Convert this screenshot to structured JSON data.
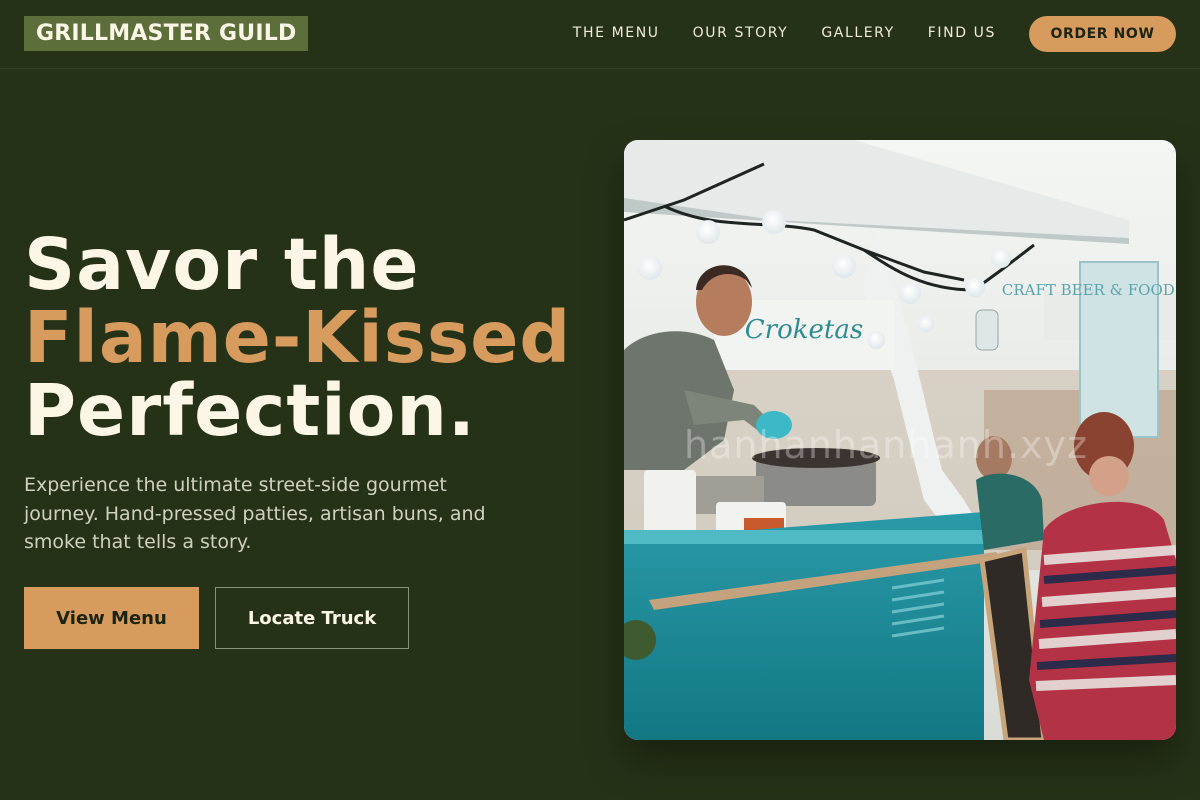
{
  "brand": {
    "name": "GRILLMASTER GUILD"
  },
  "nav": {
    "links": [
      "THE MENU",
      "OUR STORY",
      "GALLERY",
      "FIND US"
    ],
    "cta": "ORDER NOW"
  },
  "hero": {
    "title_line1": "Savor the",
    "title_line2": "Flame-Kissed",
    "title_line3": "Perfection.",
    "description": "Experience the ultimate street-side gourmet journey. Hand-pressed patties, artisan buns, and smoke that tells a story.",
    "primary_button": "View Menu",
    "secondary_button": "Locate Truck"
  },
  "image": {
    "truck_sign": "Croketas",
    "banner_text": "CRAFT BEER & FOOD TRUCK",
    "watermark": "hanhanhanhanh.xyz"
  },
  "colors": {
    "background": "#263218",
    "accent": "#d89b5e",
    "logo_bg": "#5c6e3a",
    "text": "#fbf6e6"
  }
}
